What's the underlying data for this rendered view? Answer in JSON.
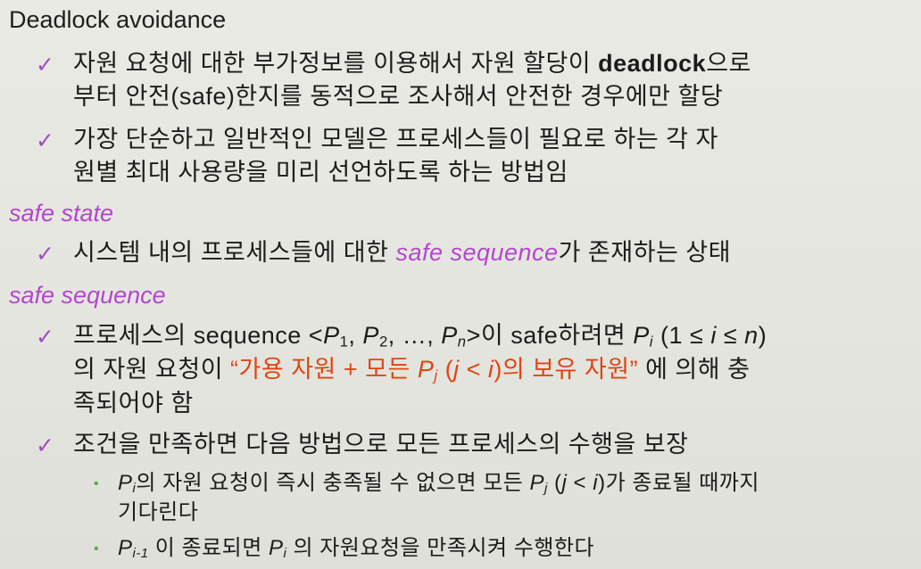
{
  "title": "Deadlock avoidance",
  "avoidance_bullets": [
    {
      "line1_a": "자원 요청에 대한 부가정보를 이용해서 자원 할당이 ",
      "line1_b": "deadlock",
      "line1_c": "으로",
      "line2": "부터 안전(safe)한지를 동적으로 조사해서 안전한 경우에만 할당"
    },
    {
      "line1": "가장 단순하고 일반적인 모델은 프로세스들이 필요로 하는 각 자",
      "line2": "원별 최대 사용량을 미리 선언하도록 하는 방법임"
    }
  ],
  "safe_state": {
    "heading": "safe state",
    "bullet_a": "시스템 내의 프로세스들에 대한 ",
    "bullet_em": "safe sequence",
    "bullet_b": "가 존재하는 상태"
  },
  "safe_sequence": {
    "heading": "safe sequence",
    "bullet1": {
      "l1_a": "프로세스의 sequence <",
      "l1_p1": "P",
      "l1_s1": "1",
      "l1_comma1": ", ",
      "l1_p2": "P",
      "l1_s2": "2",
      "l1_mid": ", …, ",
      "l1_pn": "P",
      "l1_sn": "n",
      "l1_b": ">이 safe하려면 ",
      "l1_pi": "P",
      "l1_si": "i",
      "l1_c": " (1 ≤ ",
      "l1_i": "i",
      "l1_d": " ≤ ",
      "l1_n": "n",
      "l1_e": ")",
      "l2_a": "의 자원 요청이 ",
      "l2_red_a": "“가용 자원 + 모든 ",
      "l2_red_p": "P",
      "l2_red_s": "j",
      "l2_red_b": " (",
      "l2_red_j": "j",
      "l2_red_c": " < ",
      "l2_red_i": "i",
      "l2_red_d": ")의 보유 자원”",
      "l2_b": " 에 의해 충",
      "l3": "족되어야 함"
    },
    "bullet2": {
      "text": "조건을 만족하면 다음 방법으로 모든 프로세스의 수행을 보장",
      "sub1_p": "P",
      "sub1_s": "i",
      "sub1_a": "의 자원 요청이 즉시 충족될 수 없으면 모든 ",
      "sub1_pj": "P",
      "sub1_sj": "j",
      "sub1_b": " (",
      "sub1_j": "j",
      "sub1_c": " < ",
      "sub1_i": "i",
      "sub1_d": ")가 종료될 때까지",
      "sub1_l2": "기다린다",
      "sub2_p": "P",
      "sub2_s": "i-1",
      "sub2_a": " 이 종료되면 ",
      "sub2_pi": "P",
      "sub2_si": "i",
      "sub2_b": " 의 자원요청을 만족시켜 수행한다"
    }
  },
  "icons": {
    "bullet": "checkmark-icon",
    "subbullet": "dot-icon"
  },
  "colors": {
    "background": "#e6e6e0",
    "accent_purple": "#b446cf",
    "accent_red": "#e04512",
    "check": "#a24bc2",
    "dot": "#4fae3a"
  }
}
